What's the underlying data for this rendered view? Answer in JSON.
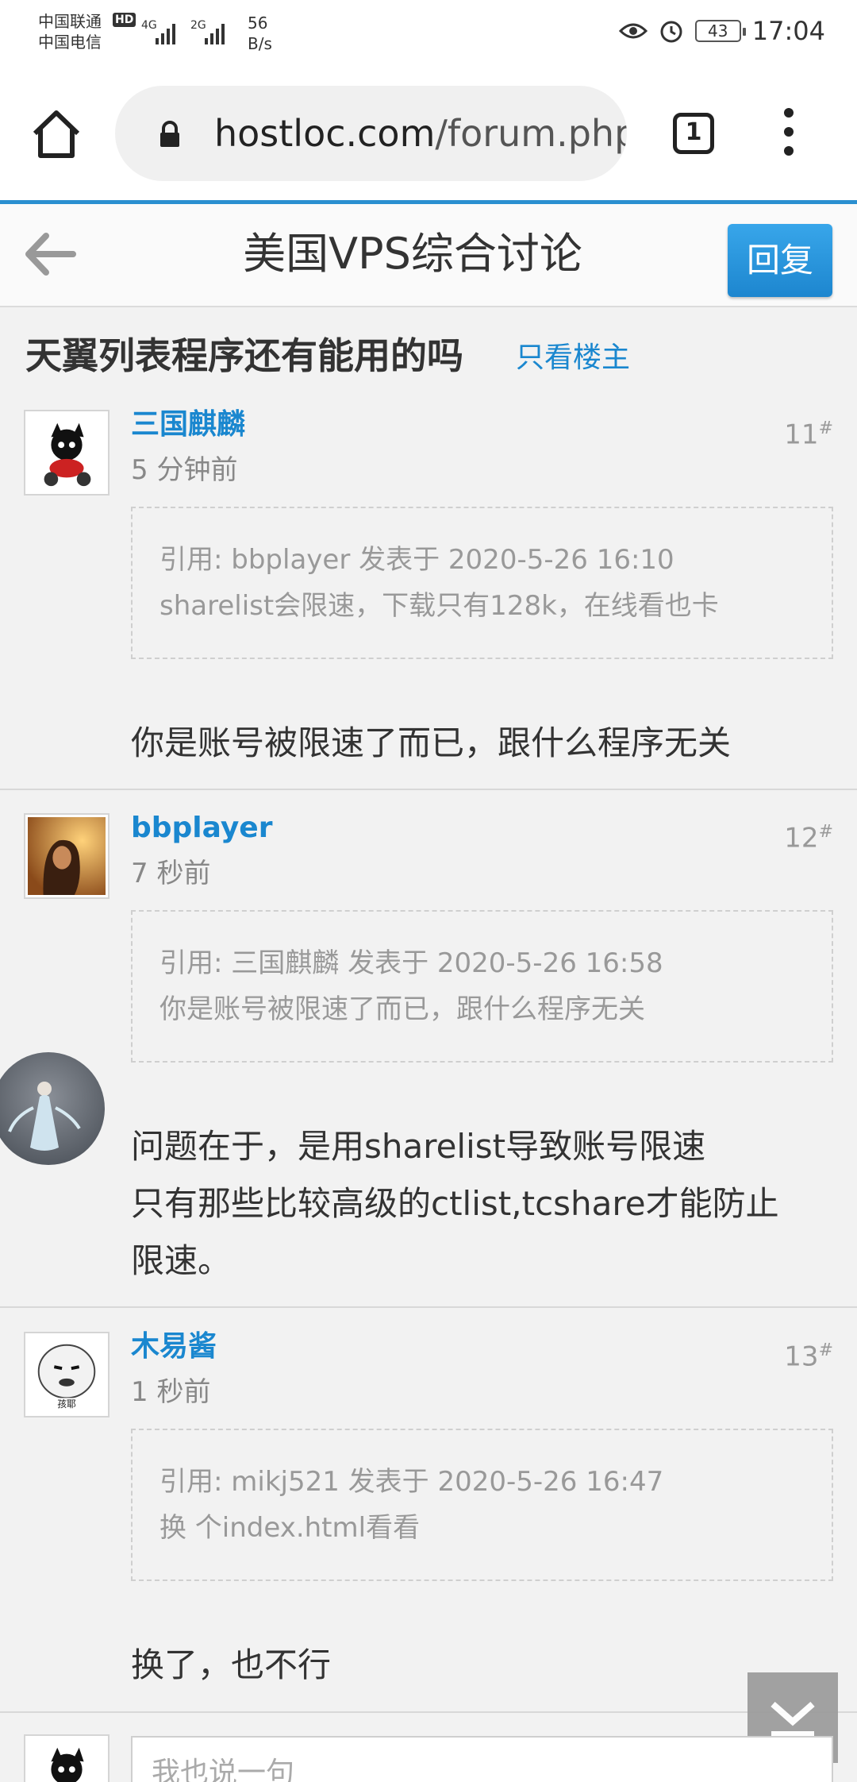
{
  "status_bar": {
    "carrier1": "中国联通",
    "carrier2": "中国电信",
    "hd_badge": "HD",
    "net1": "4G",
    "net2": "2G",
    "speed_value": "56",
    "speed_unit": "B/s",
    "battery": "43",
    "time": "17:04"
  },
  "browser": {
    "url_host": "hostloc.com",
    "url_path": "/forum.php",
    "tab_count": "1"
  },
  "forum_header": {
    "title": "美国VPS综合讨论",
    "reply_label": "回复"
  },
  "thread": {
    "title": "天翼列表程序还有能用的吗",
    "only_op_label": "只看楼主"
  },
  "posts": [
    {
      "author": "三国麒麟",
      "time": "5 分钟前",
      "floor": "11",
      "floor_mark": "#",
      "quote_line1": "引用: bbplayer 发表于 2020-5-26 16:10",
      "quote_line2": "sharelist会限速，下载只有128k，在线看也卡",
      "body_lines": [
        "你是账号被限速了而已，跟什么程序无关"
      ]
    },
    {
      "author": "bbplayer",
      "time": "7 秒前",
      "floor": "12",
      "floor_mark": "#",
      "quote_line1": "引用: 三国麒麟 发表于 2020-5-26 16:58",
      "quote_line2": "你是账号被限速了而已，跟什么程序无关",
      "body_lines": [
        "问题在于，是用sharelist导致账号限速",
        "只有那些比较高级的ctlist,tcshare才能防止",
        "限速。"
      ]
    },
    {
      "author": "木易酱",
      "time": "1 秒前",
      "floor": "13",
      "floor_mark": "#",
      "quote_line1": "引用: mikj521 发表于 2020-5-26 16:47",
      "quote_line2": "换 个index.html看看",
      "body_lines": [
        "换了，也不行"
      ]
    }
  ],
  "composer": {
    "placeholder": "我也说一句"
  },
  "colors": {
    "link_blue": "#1a87cf",
    "header_accent": "#2a8fd0",
    "reply_button": "#2b97dd"
  },
  "icons": {
    "home": "home-icon",
    "lock": "lock-icon",
    "tabs": "tabs-icon",
    "menu": "more-vert-icon",
    "back": "back-arrow-icon",
    "scroll_bottom": "scroll-to-bottom-icon"
  }
}
